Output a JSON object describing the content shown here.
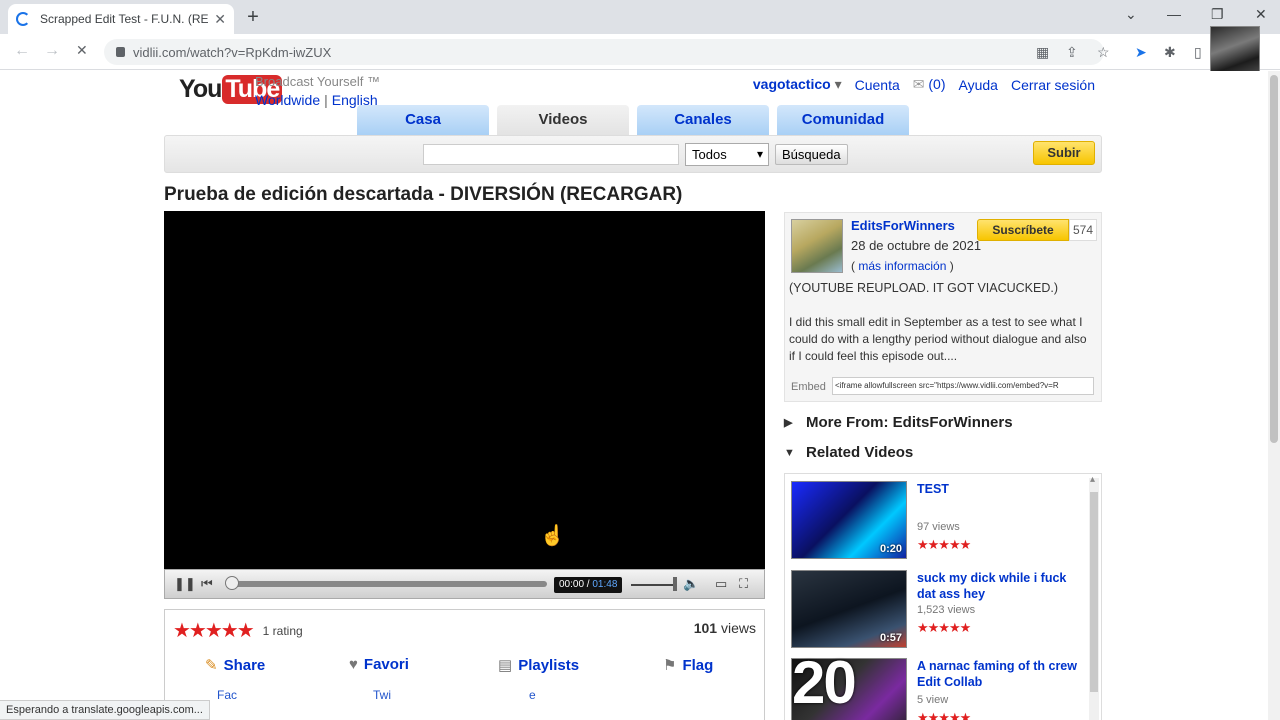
{
  "browser": {
    "tab_title": "Scrapped Edit Test - F.U.N. (REL",
    "tab_close": "✕",
    "new_tab": "+",
    "url": "vidlii.com/watch?v=RpKdm-iwZUX",
    "back": "←",
    "forward": "→",
    "reload": "✕",
    "win_chevron": "⌄",
    "win_min": "—",
    "win_restore": "❐",
    "win_close": "✕",
    "status_text": "Esperando a translate.googleapis.com..."
  },
  "site": {
    "logo_you": "You",
    "logo_tube": "Tube",
    "tagline": "Broadcast Yourself ™",
    "region": "Worldwide",
    "sep": "|",
    "language": "English"
  },
  "user_nav": {
    "username": "vagotactico",
    "dropdown": "▾",
    "account": "Cuenta",
    "inbox": "(0)",
    "help": "Ayuda",
    "logout": "Cerrar sesión"
  },
  "nav_tabs": [
    {
      "label": "Casa"
    },
    {
      "label": "Videos"
    },
    {
      "label": "Canales"
    },
    {
      "label": "Comunidad"
    }
  ],
  "search": {
    "placeholder": "",
    "category": "Todos",
    "button": "Búsqueda",
    "upload": "Subir"
  },
  "video": {
    "title": "Prueba de edición descartada - DIVERSIÓN (RECARGAR)",
    "current_time": "00:00",
    "time_sep": " / ",
    "duration": "01:48",
    "progress_fraction": 0.0,
    "stars": "★★★★★",
    "rating_count": "1 rating",
    "views_number": "101",
    "views_label": "views"
  },
  "actions": {
    "share": "Share",
    "favorite": "Favori",
    "playlists": "Playlists",
    "flag": "Flag",
    "facebook": "Fac",
    "twitter": "Twi",
    "other": "e"
  },
  "channel": {
    "name": "EditsForWinners",
    "upload_date": "28 de octubre de 2021",
    "more_info_open": "( ",
    "more_info": "más información",
    "more_info_close": " )",
    "subscribe": "Suscríbete",
    "subscribers": "574",
    "note": "(YOUTUBE REUPLOAD. IT GOT VIACUCKED.)",
    "description": "I did this small edit in September as a test to see what I could do with a lengthy period without dialogue and also if I could feel this episode out....",
    "embed_label": "Embed",
    "embed_code": "<iframe allowfullscreen src=\"https://www.vidlii.com/embed?v=R"
  },
  "sections": {
    "more_from": "More From: EditsForWinners",
    "related": "Related Videos"
  },
  "related_videos": [
    {
      "title": "TEST",
      "views": "97 views",
      "duration": "0:20",
      "stars": "★★★★★"
    },
    {
      "title": "suck my dick while i fuck dat ass hey",
      "views": "1,523 views",
      "duration": "0:57",
      "stars": "★★★★★"
    },
    {
      "title": "A  narnac   faming of th   crew   Edit Collab",
      "views": "5  view",
      "duration": "",
      "stars": "★★★★★"
    }
  ],
  "overlay": "20"
}
